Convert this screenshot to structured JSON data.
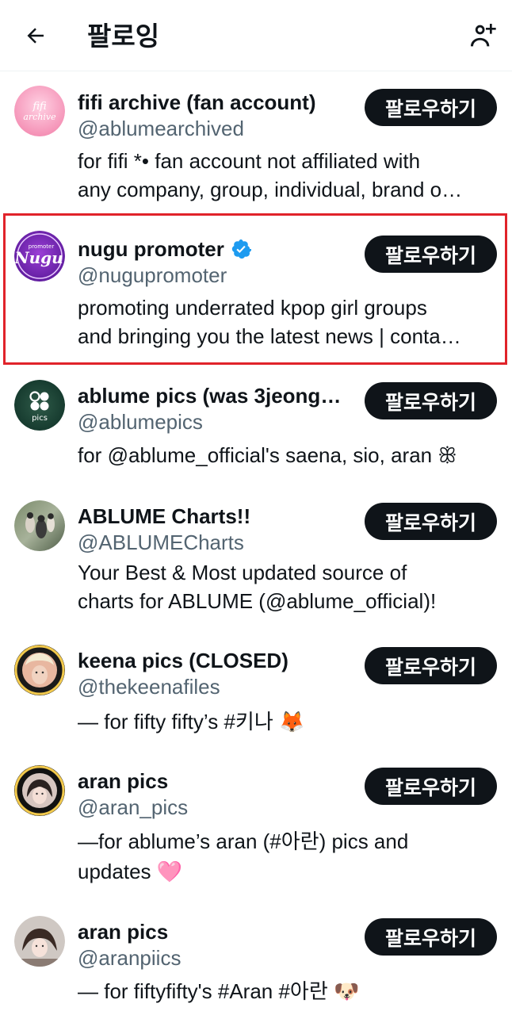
{
  "header": {
    "title": "팔로잉",
    "back_icon": "arrow-left-icon",
    "add_icon": "add-user-icon"
  },
  "colors": {
    "highlight": "#e0232a",
    "verified": "#1d9bf0",
    "button_bg": "#0f1419",
    "handle": "#536471"
  },
  "accounts": [
    {
      "name": "fifi archive (fan account)",
      "handle": "@ablumearchived",
      "bio_lines": [
        "for fifi *• fan account not affiliated with",
        "any company, group, individual, brand o…"
      ],
      "follow_label": "팔로우하기",
      "avatar_text": "fifi archive",
      "verified": false
    },
    {
      "name": "nugu promoter",
      "handle": "@nugupromoter",
      "bio_lines": [
        "promoting underrated kpop girl groups",
        "and bringing you the latest news | conta…"
      ],
      "follow_label": "팔로우하기",
      "avatar_text": "Nugu",
      "avatar_subtext": "promoter",
      "verified": true,
      "highlighted": true
    },
    {
      "name": "ablume pics (was 3jeong…",
      "handle": "@ablumepics",
      "bio_lines": [
        "for @ablume_official's saena, sio, aran ꕥ"
      ],
      "follow_label": "팔로우하기",
      "avatar_text": "pics",
      "verified": false
    },
    {
      "name": "ABLUME Charts!!",
      "handle": "@ABLUMECharts",
      "bio_lines": [
        "Your Best & Most updated source of",
        "charts for ABLUME (@ablume_official)!"
      ],
      "follow_label": "팔로우하기",
      "verified": false
    },
    {
      "name": "keena pics (CLOSED)",
      "handle": "@thekeenafiles",
      "bio_lines": [
        "— for fifty fifty’s #키나 🦊"
      ],
      "follow_label": "팔로우하기",
      "verified": false
    },
    {
      "name": "aran pics",
      "handle": "@aran_pics",
      "bio_lines": [
        "—for ablume’s aran (#아란) pics and",
        "updates 🩷"
      ],
      "follow_label": "팔로우하기",
      "verified": false
    },
    {
      "name": "aran pics",
      "handle": "@aranpiics",
      "bio_lines": [
        "— for fiftyfifty's #Aran #아란 🐶"
      ],
      "follow_label": "팔로우하기",
      "verified": false
    }
  ]
}
